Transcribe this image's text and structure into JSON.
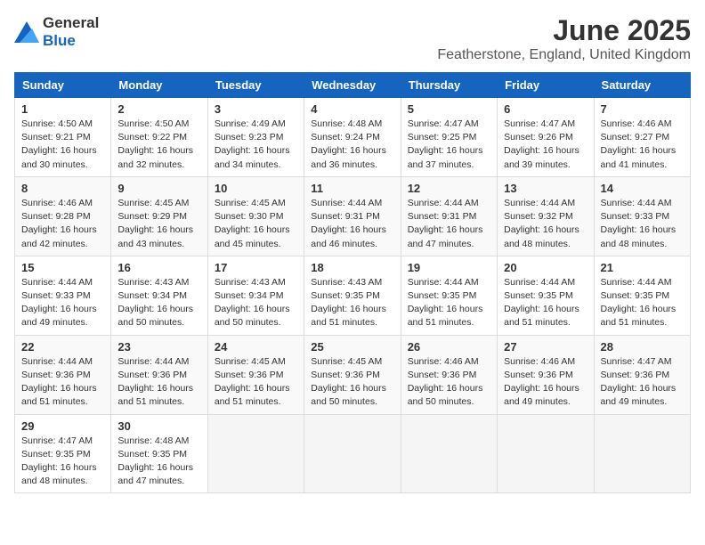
{
  "logo": {
    "general": "General",
    "blue": "Blue"
  },
  "title": "June 2025",
  "subtitle": "Featherstone, England, United Kingdom",
  "days_header": [
    "Sunday",
    "Monday",
    "Tuesday",
    "Wednesday",
    "Thursday",
    "Friday",
    "Saturday"
  ],
  "weeks": [
    [
      {
        "day": "1",
        "info": "Sunrise: 4:50 AM\nSunset: 9:21 PM\nDaylight: 16 hours and 30 minutes."
      },
      {
        "day": "2",
        "info": "Sunrise: 4:50 AM\nSunset: 9:22 PM\nDaylight: 16 hours and 32 minutes."
      },
      {
        "day": "3",
        "info": "Sunrise: 4:49 AM\nSunset: 9:23 PM\nDaylight: 16 hours and 34 minutes."
      },
      {
        "day": "4",
        "info": "Sunrise: 4:48 AM\nSunset: 9:24 PM\nDaylight: 16 hours and 36 minutes."
      },
      {
        "day": "5",
        "info": "Sunrise: 4:47 AM\nSunset: 9:25 PM\nDaylight: 16 hours and 37 minutes."
      },
      {
        "day": "6",
        "info": "Sunrise: 4:47 AM\nSunset: 9:26 PM\nDaylight: 16 hours and 39 minutes."
      },
      {
        "day": "7",
        "info": "Sunrise: 4:46 AM\nSunset: 9:27 PM\nDaylight: 16 hours and 41 minutes."
      }
    ],
    [
      {
        "day": "8",
        "info": "Sunrise: 4:46 AM\nSunset: 9:28 PM\nDaylight: 16 hours and 42 minutes."
      },
      {
        "day": "9",
        "info": "Sunrise: 4:45 AM\nSunset: 9:29 PM\nDaylight: 16 hours and 43 minutes."
      },
      {
        "day": "10",
        "info": "Sunrise: 4:45 AM\nSunset: 9:30 PM\nDaylight: 16 hours and 45 minutes."
      },
      {
        "day": "11",
        "info": "Sunrise: 4:44 AM\nSunset: 9:31 PM\nDaylight: 16 hours and 46 minutes."
      },
      {
        "day": "12",
        "info": "Sunrise: 4:44 AM\nSunset: 9:31 PM\nDaylight: 16 hours and 47 minutes."
      },
      {
        "day": "13",
        "info": "Sunrise: 4:44 AM\nSunset: 9:32 PM\nDaylight: 16 hours and 48 minutes."
      },
      {
        "day": "14",
        "info": "Sunrise: 4:44 AM\nSunset: 9:33 PM\nDaylight: 16 hours and 48 minutes."
      }
    ],
    [
      {
        "day": "15",
        "info": "Sunrise: 4:44 AM\nSunset: 9:33 PM\nDaylight: 16 hours and 49 minutes."
      },
      {
        "day": "16",
        "info": "Sunrise: 4:43 AM\nSunset: 9:34 PM\nDaylight: 16 hours and 50 minutes."
      },
      {
        "day": "17",
        "info": "Sunrise: 4:43 AM\nSunset: 9:34 PM\nDaylight: 16 hours and 50 minutes."
      },
      {
        "day": "18",
        "info": "Sunrise: 4:43 AM\nSunset: 9:35 PM\nDaylight: 16 hours and 51 minutes."
      },
      {
        "day": "19",
        "info": "Sunrise: 4:44 AM\nSunset: 9:35 PM\nDaylight: 16 hours and 51 minutes."
      },
      {
        "day": "20",
        "info": "Sunrise: 4:44 AM\nSunset: 9:35 PM\nDaylight: 16 hours and 51 minutes."
      },
      {
        "day": "21",
        "info": "Sunrise: 4:44 AM\nSunset: 9:35 PM\nDaylight: 16 hours and 51 minutes."
      }
    ],
    [
      {
        "day": "22",
        "info": "Sunrise: 4:44 AM\nSunset: 9:36 PM\nDaylight: 16 hours and 51 minutes."
      },
      {
        "day": "23",
        "info": "Sunrise: 4:44 AM\nSunset: 9:36 PM\nDaylight: 16 hours and 51 minutes."
      },
      {
        "day": "24",
        "info": "Sunrise: 4:45 AM\nSunset: 9:36 PM\nDaylight: 16 hours and 51 minutes."
      },
      {
        "day": "25",
        "info": "Sunrise: 4:45 AM\nSunset: 9:36 PM\nDaylight: 16 hours and 50 minutes."
      },
      {
        "day": "26",
        "info": "Sunrise: 4:46 AM\nSunset: 9:36 PM\nDaylight: 16 hours and 50 minutes."
      },
      {
        "day": "27",
        "info": "Sunrise: 4:46 AM\nSunset: 9:36 PM\nDaylight: 16 hours and 49 minutes."
      },
      {
        "day": "28",
        "info": "Sunrise: 4:47 AM\nSunset: 9:36 PM\nDaylight: 16 hours and 49 minutes."
      }
    ],
    [
      {
        "day": "29",
        "info": "Sunrise: 4:47 AM\nSunset: 9:35 PM\nDaylight: 16 hours and 48 minutes."
      },
      {
        "day": "30",
        "info": "Sunrise: 4:48 AM\nSunset: 9:35 PM\nDaylight: 16 hours and 47 minutes."
      },
      null,
      null,
      null,
      null,
      null
    ]
  ]
}
